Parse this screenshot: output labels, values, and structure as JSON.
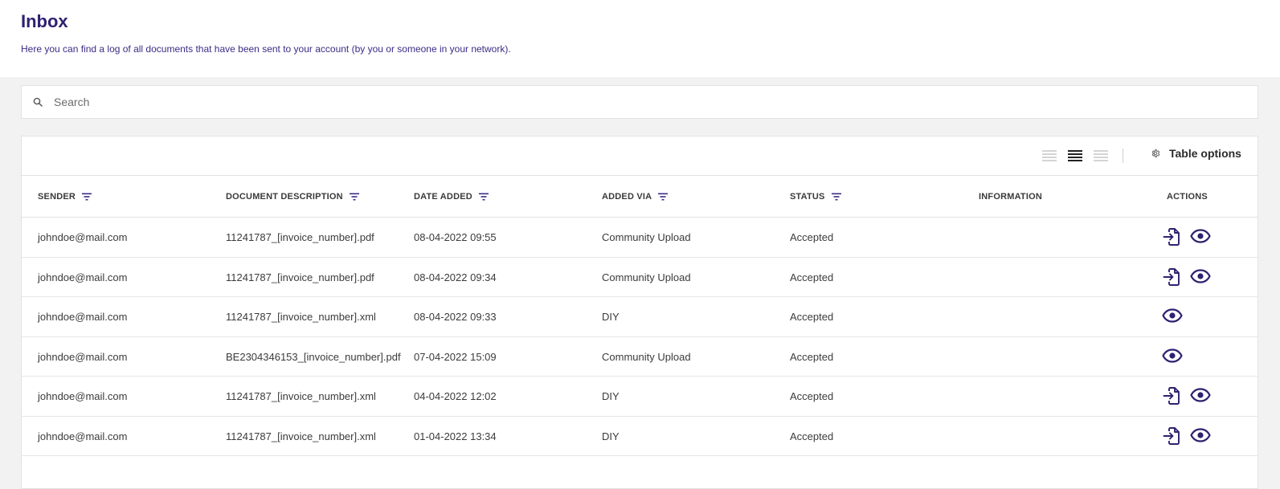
{
  "header": {
    "title": "Inbox",
    "subtitle": "Here you can find a log of all documents that have been sent to your account (by you or someone in your network)."
  },
  "search": {
    "placeholder": "Search"
  },
  "toolbar": {
    "density_options": [
      "compact",
      "standard",
      "comfortable"
    ],
    "selected_density": "standard",
    "table_options_label": "Table options"
  },
  "table": {
    "columns": {
      "sender": "SENDER",
      "description": "DOCUMENT DESCRIPTION",
      "date": "DATE ADDED",
      "via": "ADDED VIA",
      "status": "STATUS",
      "information": "INFORMATION",
      "actions": "ACTIONS"
    },
    "rows": [
      {
        "sender": "johndoe@mail.com",
        "description": "11241787_[invoice_number].pdf",
        "date": "08-04-2022 09:55",
        "via": "Community Upload",
        "status": "Accepted",
        "information": "",
        "icons": [
          "download-icon",
          "eye-icon"
        ]
      },
      {
        "sender": "johndoe@mail.com",
        "description": "11241787_[invoice_number].pdf",
        "date": "08-04-2022 09:34",
        "via": "Community Upload",
        "status": "Accepted",
        "information": "",
        "icons": [
          "download-icon",
          "eye-icon"
        ]
      },
      {
        "sender": "johndoe@mail.com",
        "description": "11241787_[invoice_number].xml",
        "date": "08-04-2022 09:33",
        "via": "DIY",
        "status": "Accepted",
        "information": "",
        "icons": [
          "eye-icon"
        ]
      },
      {
        "sender": "johndoe@mail.com",
        "description": "BE2304346153_[invoice_number].pdf",
        "date": "07-04-2022 15:09",
        "via": "Community Upload",
        "status": "Accepted",
        "information": "",
        "icons": [
          "eye-icon"
        ]
      },
      {
        "sender": "johndoe@mail.com",
        "description": "11241787_[invoice_number].xml",
        "date": "04-04-2022 12:02",
        "via": "DIY",
        "status": "Accepted",
        "information": "",
        "icons": [
          "download-icon",
          "eye-icon"
        ]
      },
      {
        "sender": "johndoe@mail.com",
        "description": "11241787_[invoice_number].xml",
        "date": "01-04-2022 13:34",
        "via": "DIY",
        "status": "Accepted",
        "information": "",
        "icons": [
          "download-icon",
          "eye-icon"
        ]
      }
    ]
  },
  "colors": {
    "brand": "#2f2170",
    "subtitle": "#3d2b86",
    "page_bg": "#f2f2f2"
  }
}
